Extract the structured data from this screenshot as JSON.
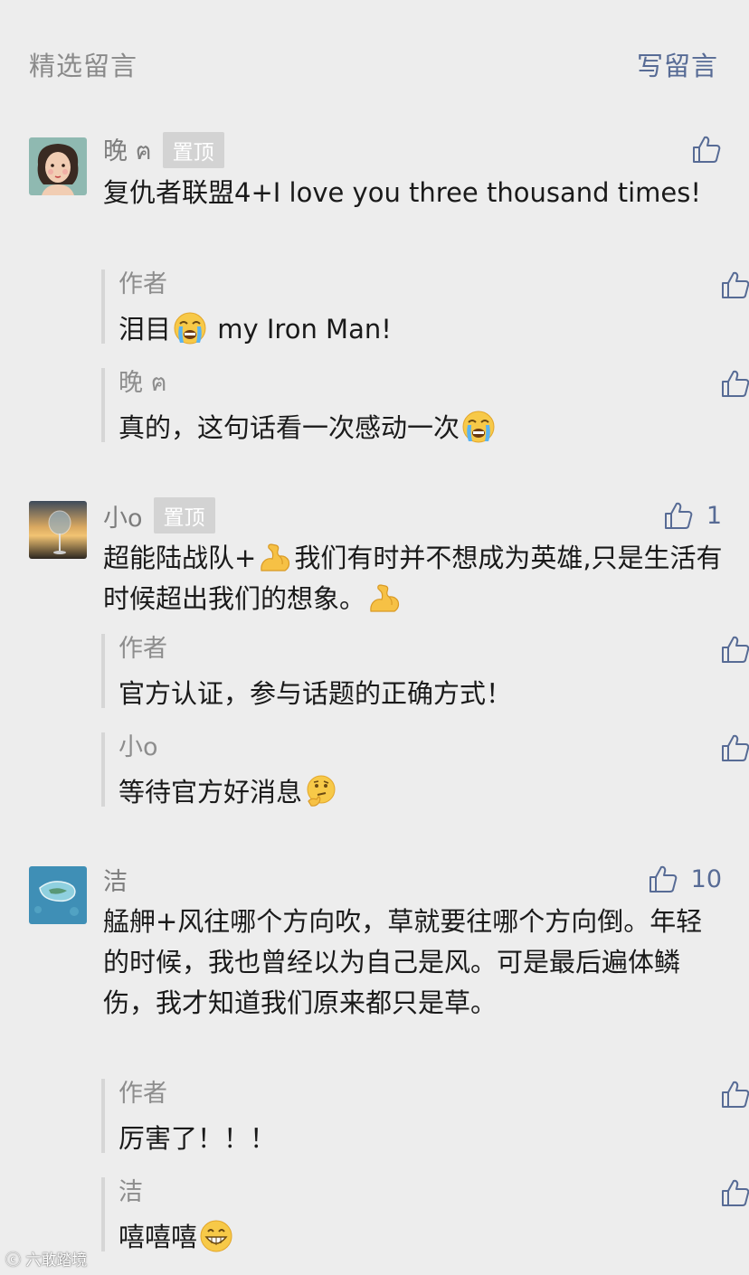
{
  "header": {
    "title": "精选留言",
    "write_label": "写留言"
  },
  "comments": [
    {
      "name": "晚 ฅ",
      "pin_label": "置顶",
      "text_before": "复仇者联盟4+I love you three thousand times!",
      "replies": [
        {
          "name": "作者",
          "text_before": "泪目",
          "emoji": "crying-face-emoji",
          "text_after": " my Iron Man!"
        },
        {
          "name": "晚 ฅ",
          "text_before": "真的，这句话看一次感动一次",
          "emoji": "crying-face-emoji",
          "text_after": ""
        }
      ]
    },
    {
      "name": "小o",
      "pin_label": "置顶",
      "like_count": "1",
      "text_before": "超能陆战队+",
      "text_mid": "我们有时并不想成为英雄,只是生活有时候超出我们的想象。",
      "emoji": "flexed-biceps-emoji",
      "replies": [
        {
          "name": "作者",
          "text_before": "官方认证，参与话题的正确方式！",
          "emoji": "",
          "text_after": ""
        },
        {
          "name": "小o",
          "text_before": "等待官方好消息",
          "emoji": "thinking-face-emoji",
          "text_after": ""
        }
      ]
    },
    {
      "name": "洁",
      "like_count": "10",
      "text_before": "艋舺+风往哪个方向吹，草就要往哪个方向倒。年轻的时候，我也曾经以为自己是风。可是最后遍体鳞伤，我才知道我们原来都只是草。",
      "replies": [
        {
          "name": "作者",
          "text_before": "厉害了！！！",
          "emoji": "",
          "text_after": ""
        },
        {
          "name": "洁",
          "text_before": "嘻嘻嘻",
          "emoji": "grinning-face-emoji",
          "text_after": ""
        }
      ]
    }
  ],
  "watermark": "六敢踏境",
  "colors": {
    "background": "#ededed",
    "link": "#576b95",
    "muted": "#8a8a8a",
    "pin_bg": "#d3d3d3",
    "reply_bar": "#d6d6d6"
  }
}
